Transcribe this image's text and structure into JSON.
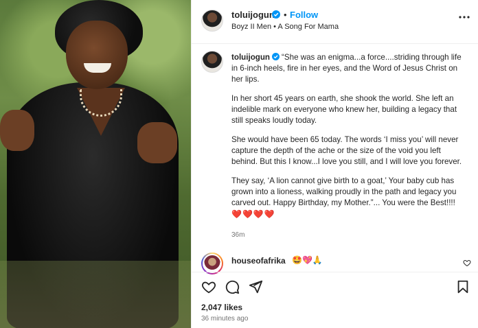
{
  "post": {
    "photo_alt": "Portrait photo"
  },
  "header": {
    "username": "toluijogun",
    "dot": "•",
    "follow_label": "Follow",
    "audio": "Boyz II Men • A Song For Mama"
  },
  "caption": {
    "username": "toluijogun",
    "paragraphs": [
      "“She was an enigma...a force....striding through life in 6-inch heels, fire in her eyes, and the Word of Jesus Christ on her lips.",
      "In her short 45 years on earth, she shook the world. She left an indelible mark on everyone who knew her, building a legacy that still speaks loudly today.",
      "She would have been 65 today. The words ‘I miss you’ will never capture the depth of the ache or the size of the void you left behind. But this I know...I love you still, and I will love you forever.",
      "They say, ‘A lion cannot give birth to a goat,’ Your baby cub has grown into a lioness, walking proudly in the path and legacy you carved out. Happy Birthday, my Mother.”... You were the Best!!!!"
    ],
    "hearts": "❤️❤️❤️❤️",
    "time_ago": "36m"
  },
  "comment": {
    "username": "houseofafrika",
    "emojis": "🤩💖🙏"
  },
  "footer": {
    "likes": "2,047 likes",
    "posted": "36 minutes ago"
  },
  "colors": {
    "accent": "#0095f6",
    "heart": "#ed4956",
    "text": "#262626",
    "muted": "#737373"
  },
  "icons": [
    "verified-badge-icon",
    "more-options-icon",
    "heart-icon",
    "comment-icon",
    "share-icon",
    "bookmark-icon"
  ]
}
